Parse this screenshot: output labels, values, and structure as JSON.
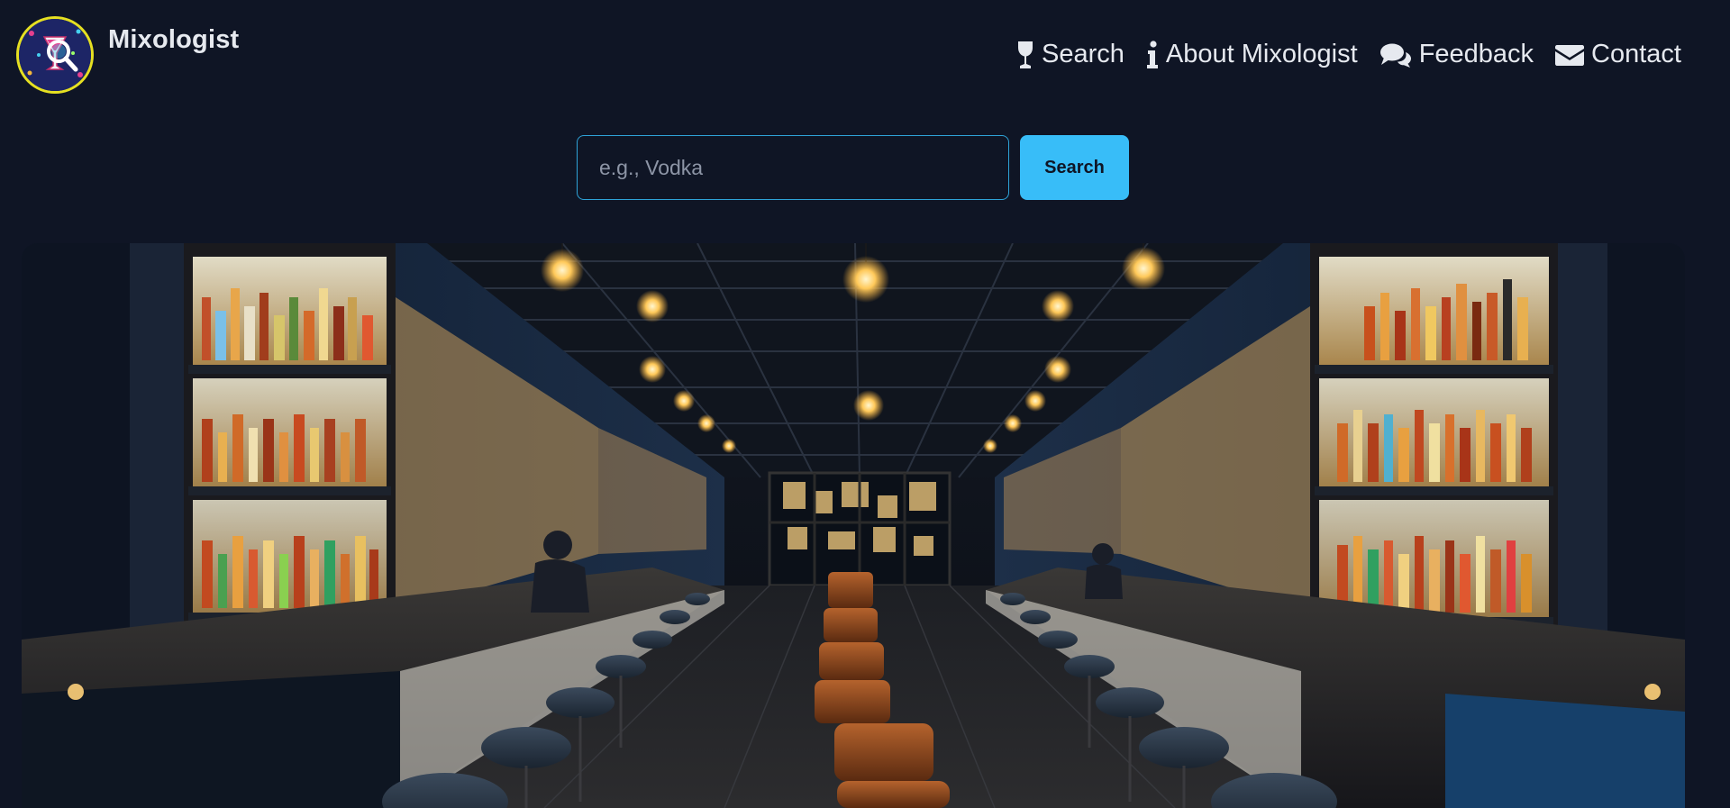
{
  "app": {
    "brand": "Mixologist",
    "logo_icon": "cocktail-magnifier-logo"
  },
  "nav": {
    "items": [
      {
        "label": "Search",
        "icon": "wine-glass-icon"
      },
      {
        "label": "About Mixologist",
        "icon": "info-icon"
      },
      {
        "label": "Feedback",
        "icon": "comments-icon"
      },
      {
        "label": "Contact",
        "icon": "envelope-icon"
      }
    ]
  },
  "search": {
    "placeholder": "e.g., Vodka",
    "value": "",
    "button_label": "Search"
  },
  "hero": {
    "image": "bar-interior-photo"
  },
  "colors": {
    "background": "#0f1525",
    "accent": "#38bdf8",
    "logo_ring": "#e6e021",
    "text": "#e6e9ef"
  }
}
